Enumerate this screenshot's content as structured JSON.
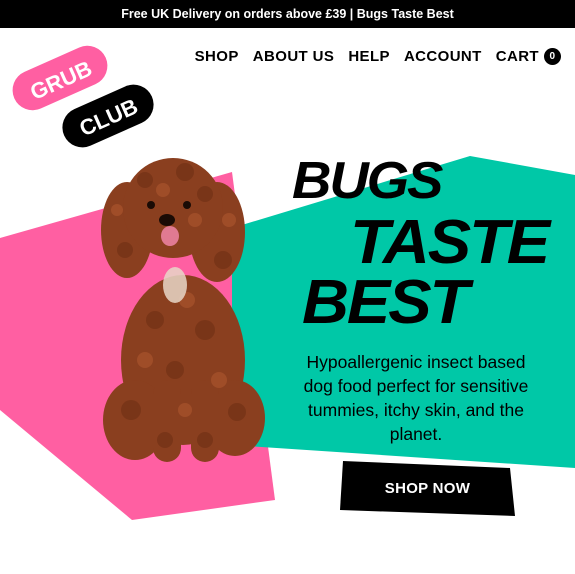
{
  "announcement": "Free UK Delivery on orders above £39 | Bugs Taste Best",
  "logo": {
    "line1": "GRUB",
    "line2": "CLUB"
  },
  "nav": {
    "items": [
      {
        "label": "SHOP"
      },
      {
        "label": "ABOUT US"
      },
      {
        "label": "HELP"
      },
      {
        "label": "ACCOUNT"
      },
      {
        "label": "CART"
      }
    ],
    "cart_count": "0"
  },
  "hero": {
    "headline_line1": "BUGS",
    "headline_line2": "TASTE",
    "headline_line3": "BEST",
    "description": "Hypoallergenic insect based dog food perfect for sensitive tummies, itchy skin, and the planet.",
    "cta_label": "SHOP NOW",
    "image": "dog-photo"
  },
  "colors": {
    "pink": "#ff5fa2",
    "teal": "#00c8a7",
    "black": "#000000",
    "white": "#ffffff",
    "dog": "#8a3f1f"
  }
}
